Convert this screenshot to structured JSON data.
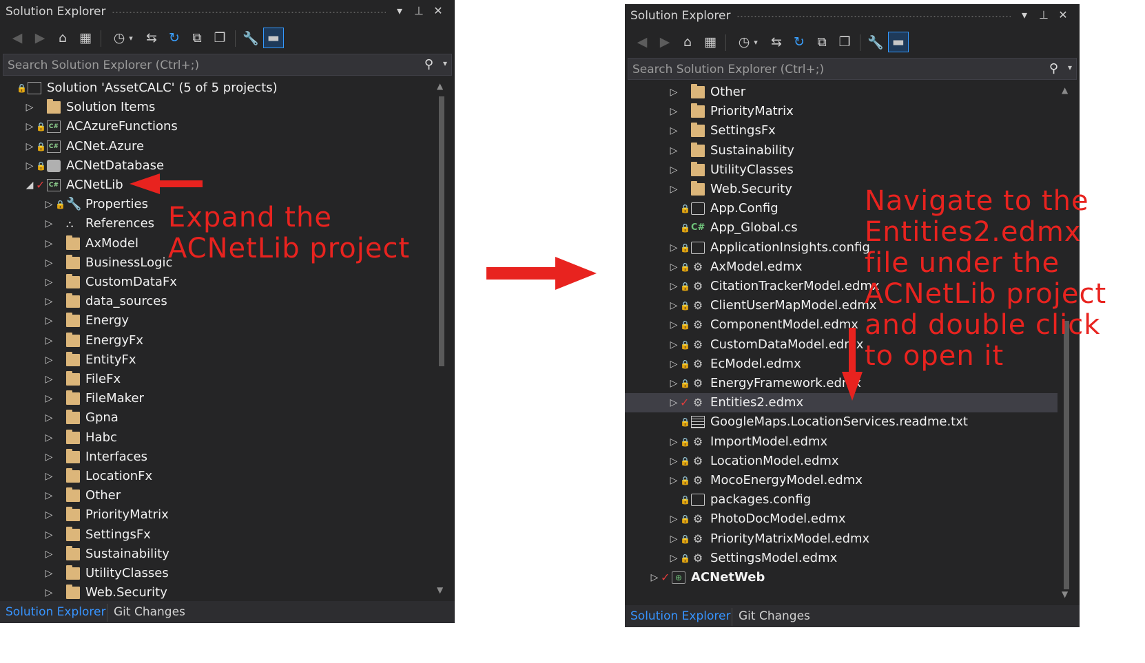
{
  "left_panel": {
    "title": "Solution Explorer",
    "search_placeholder": "Search Solution Explorer (Ctrl+;)",
    "tree": [
      {
        "label": "Solution 'AssetCALC' (5 of 5 projects)",
        "icon": "solution-icon",
        "lock": true
      },
      {
        "label": "Solution Items",
        "icon": "folder-icon",
        "expander": "collapsed"
      },
      {
        "label": "ACAzureFunctions",
        "icon": "csharp-project-icon",
        "lock": true,
        "expander": "collapsed"
      },
      {
        "label": "ACNet.Azure",
        "icon": "csharp-project-icon",
        "lock": true,
        "expander": "collapsed"
      },
      {
        "label": "ACNetDatabase",
        "icon": "database-project-icon",
        "lock": true,
        "expander": "collapsed"
      },
      {
        "label": "ACNetLib",
        "icon": "csharp-project-icon",
        "checked": true,
        "expander": "expanded"
      },
      {
        "label": "Properties",
        "icon": "wrench-icon",
        "lock": true,
        "expander": "collapsed"
      },
      {
        "label": "References",
        "icon": "references-icon",
        "expander": "collapsed"
      },
      {
        "label": "AxModel",
        "icon": "folder-icon",
        "expander": "collapsed"
      },
      {
        "label": "BusinessLogic",
        "icon": "folder-icon",
        "expander": "collapsed"
      },
      {
        "label": "CustomDataFx",
        "icon": "folder-icon",
        "expander": "collapsed"
      },
      {
        "label": "data_sources",
        "icon": "folder-icon",
        "expander": "collapsed"
      },
      {
        "label": "Energy",
        "icon": "folder-icon",
        "expander": "collapsed"
      },
      {
        "label": "EnergyFx",
        "icon": "folder-icon",
        "expander": "collapsed"
      },
      {
        "label": "EntityFx",
        "icon": "folder-icon",
        "expander": "collapsed"
      },
      {
        "label": "FileFx",
        "icon": "folder-icon",
        "expander": "collapsed"
      },
      {
        "label": "FileMaker",
        "icon": "folder-icon",
        "expander": "collapsed"
      },
      {
        "label": "Gpna",
        "icon": "folder-icon",
        "expander": "collapsed"
      },
      {
        "label": "Habc",
        "icon": "folder-icon",
        "expander": "collapsed"
      },
      {
        "label": "Interfaces",
        "icon": "folder-icon",
        "expander": "collapsed"
      },
      {
        "label": "LocationFx",
        "icon": "folder-icon",
        "expander": "collapsed"
      },
      {
        "label": "Other",
        "icon": "folder-icon",
        "expander": "collapsed"
      },
      {
        "label": "PriorityMatrix",
        "icon": "folder-icon",
        "expander": "collapsed"
      },
      {
        "label": "SettingsFx",
        "icon": "folder-icon",
        "expander": "collapsed"
      },
      {
        "label": "Sustainability",
        "icon": "folder-icon",
        "expander": "collapsed"
      },
      {
        "label": "UtilityClasses",
        "icon": "folder-icon",
        "expander": "collapsed"
      },
      {
        "label": "Web.Security",
        "icon": "folder-icon",
        "expander": "collapsed"
      }
    ],
    "tabs": [
      "Solution Explorer",
      "Git Changes"
    ]
  },
  "right_panel": {
    "title": "Solution Explorer",
    "search_placeholder": "Search Solution Explorer (Ctrl+;)",
    "tree": [
      {
        "label": "Other",
        "icon": "folder-icon",
        "expander": "collapsed"
      },
      {
        "label": "PriorityMatrix",
        "icon": "folder-icon",
        "expander": "collapsed"
      },
      {
        "label": "SettingsFx",
        "icon": "folder-icon",
        "expander": "collapsed"
      },
      {
        "label": "Sustainability",
        "icon": "folder-icon",
        "expander": "collapsed"
      },
      {
        "label": "UtilityClasses",
        "icon": "folder-icon",
        "expander": "collapsed"
      },
      {
        "label": "Web.Security",
        "icon": "folder-icon",
        "expander": "collapsed"
      },
      {
        "label": "App.Config",
        "icon": "config-file-icon",
        "lock": true
      },
      {
        "label": "App_Global.cs",
        "icon": "csharp-file-icon",
        "lock": true
      },
      {
        "label": "ApplicationInsights.config",
        "icon": "config-file-icon",
        "lock": true,
        "expander": "collapsed"
      },
      {
        "label": "AxModel.edmx",
        "icon": "edmx-icon",
        "lock": true,
        "expander": "collapsed"
      },
      {
        "label": "CitationTrackerModel.edmx",
        "icon": "edmx-icon",
        "lock": true,
        "expander": "collapsed"
      },
      {
        "label": "ClientUserMapModel.edmx",
        "icon": "edmx-icon",
        "lock": true,
        "expander": "collapsed"
      },
      {
        "label": "ComponentModel.edmx",
        "icon": "edmx-icon",
        "lock": true,
        "expander": "collapsed"
      },
      {
        "label": "CustomDataModel.edmx",
        "icon": "edmx-icon",
        "lock": true,
        "expander": "collapsed"
      },
      {
        "label": "EcModel.edmx",
        "icon": "edmx-icon",
        "lock": true,
        "expander": "collapsed"
      },
      {
        "label": "EnergyFramework.edmx",
        "icon": "edmx-icon",
        "lock": true,
        "expander": "collapsed"
      },
      {
        "label": "Entities2.edmx",
        "icon": "edmx-icon",
        "checked": true,
        "expander": "collapsed",
        "selected": true
      },
      {
        "label": "GoogleMaps.LocationServices.readme.txt",
        "icon": "text-file-icon",
        "lock": true
      },
      {
        "label": "ImportModel.edmx",
        "icon": "edmx-icon",
        "lock": true,
        "expander": "collapsed"
      },
      {
        "label": "LocationModel.edmx",
        "icon": "edmx-icon",
        "lock": true,
        "expander": "collapsed"
      },
      {
        "label": "MocoEnergyModel.edmx",
        "icon": "edmx-icon",
        "lock": true,
        "expander": "collapsed"
      },
      {
        "label": "packages.config",
        "icon": "config-file-icon",
        "lock": true
      },
      {
        "label": "PhotoDocModel.edmx",
        "icon": "edmx-icon",
        "lock": true,
        "expander": "collapsed"
      },
      {
        "label": "PriorityMatrixModel.edmx",
        "icon": "edmx-icon",
        "lock": true,
        "expander": "collapsed"
      },
      {
        "label": "SettingsModel.edmx",
        "icon": "edmx-icon",
        "lock": true,
        "expander": "collapsed"
      },
      {
        "label": "ACNetWeb",
        "icon": "web-project-icon",
        "checked": true,
        "expander": "collapsed",
        "bold": true
      }
    ],
    "tabs": [
      "Solution Explorer",
      "Git Changes"
    ]
  },
  "annotations": {
    "left_lines": [
      "Expand the",
      "ACNetLib project"
    ],
    "right_lines": [
      "Navigate to the",
      "Entities2.edmx",
      "file under the",
      "ACNetLib project",
      "and double click",
      "to open it"
    ]
  },
  "colors": {
    "panel_bg": "#252526",
    "annotation_red": "#e8231f",
    "accent_blue": "#3794ff",
    "folder": "#dcb67a"
  }
}
